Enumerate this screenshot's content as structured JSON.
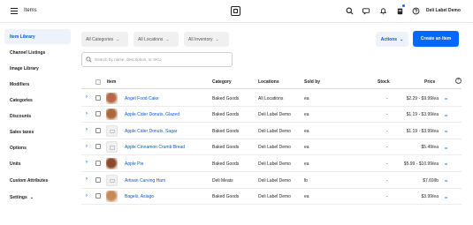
{
  "topbar": {
    "title": "Items",
    "account_name": "Deli Label Demo",
    "icons": [
      "menu-icon",
      "square-logo-icon",
      "search-icon",
      "chat-icon",
      "bell-icon",
      "clipboard-icon",
      "help-icon"
    ],
    "accent": "#006aff"
  },
  "sidebar": {
    "items": [
      {
        "label": "Item Library",
        "active": true
      },
      {
        "label": "Channel Listings"
      },
      {
        "label": "Image Library"
      },
      {
        "label": "Modifiers"
      },
      {
        "label": "Categories"
      },
      {
        "label": "Discounts"
      },
      {
        "label": "Sales taxes"
      },
      {
        "label": "Options"
      },
      {
        "label": "Units"
      },
      {
        "label": "Custom Attributes"
      },
      {
        "label": "Settings"
      }
    ]
  },
  "filters": {
    "categories": "All Categories",
    "locations": "All Locations",
    "inventory": "All Inventory"
  },
  "toolbar": {
    "actions_label": "Actions",
    "create_label": "Create an item"
  },
  "search": {
    "placeholder": "Search by name, description, or SKU",
    "value": ""
  },
  "table": {
    "columns": [
      "Item",
      "Category",
      "Locations",
      "Sold by",
      "Stock",
      "Price"
    ],
    "rows": [
      {
        "name": "Angel Food Cake",
        "category": "Baked Goods",
        "locations": "All Locations",
        "sold_by": "ea",
        "stock": "-",
        "price": "$2.29 - $9.99/ea",
        "photo": true,
        "photo_color": "#b8684a"
      },
      {
        "name": "Apple Cider Donuts, Glazed",
        "category": "Baked Goods",
        "locations": "Deli Label Demo",
        "sold_by": "ea",
        "stock": "-",
        "price": "$1.19 - $3.99/ea",
        "photo": true,
        "photo_color": "#a9683f"
      },
      {
        "name": "Apple Cider Donuts, Sugar",
        "category": "Baked Goods",
        "locations": "Deli Label Demo",
        "sold_by": "ea",
        "stock": "-",
        "price": "$1.19 - $3.99/ea",
        "photo": false
      },
      {
        "name": "Apple Cinnamon Crumb Bread",
        "category": "Baked Goods",
        "locations": "Deli Label Demo",
        "sold_by": "ea",
        "stock": "-",
        "price": "$5.49/ea",
        "photo": false
      },
      {
        "name": "Apple Pie",
        "category": "Baked Goods",
        "locations": "Deli Label Demo",
        "sold_by": "ea",
        "stock": "-",
        "price": "$5.99 - $10.99/ea",
        "photo": true,
        "photo_color": "#8a4a2e"
      },
      {
        "name": "Artisan Carving Ham",
        "category": "Deli Meats",
        "locations": "Deli Label Demo",
        "sold_by": "lb",
        "stock": "-",
        "price": "$7.69/lb",
        "photo": false
      },
      {
        "name": "Bagels, Asiago",
        "category": "Baked Goods",
        "locations": "Deli Label Demo",
        "sold_by": "ea",
        "stock": "-",
        "price": "$3.99/ea",
        "photo": true,
        "photo_color": "#c48a58"
      }
    ]
  }
}
